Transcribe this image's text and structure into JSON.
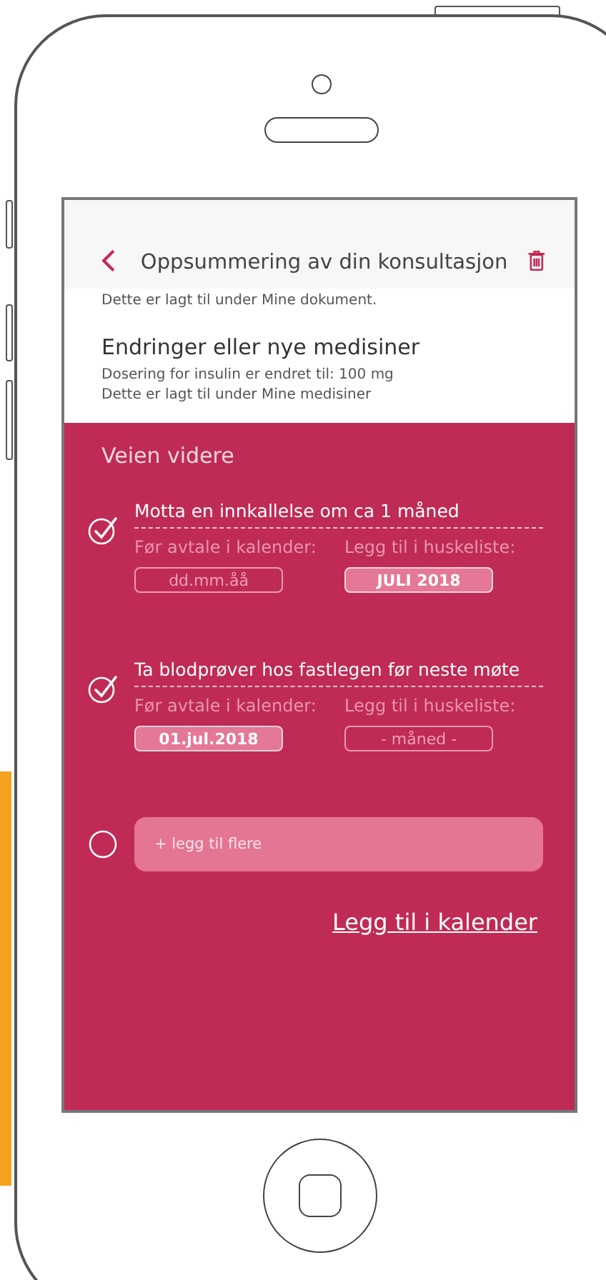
{
  "header": {
    "title": "Oppsummering av din konsultasjon"
  },
  "intro_text": "Dette er lagt til under Mine dokument.",
  "medicine": {
    "title": "Endringer eller nye medisiner",
    "lines": [
      "Dosering for insulin er endret til: 100 mg",
      "Dette er lagt til under Mine medisiner"
    ]
  },
  "next_steps": {
    "title": "Veien videre",
    "tasks": [
      {
        "title": "Motta en innkallelse om ca 1 måned",
        "checked": true,
        "calendar_label": "Før avtale i kalender:",
        "calendar_field": {
          "placeholder": "dd.mm.åå"
        },
        "reminder_label": "Legg til i huskeliste:",
        "reminder_field": {
          "value": "JULI 2018"
        }
      },
      {
        "title": "Ta blodprøver hos fastlegen før neste møte",
        "checked": true,
        "calendar_label": "Før avtale i kalender:",
        "calendar_field": {
          "value": "01.jul.2018"
        },
        "reminder_label": "Legg til i huskeliste:",
        "reminder_field": {
          "placeholder": "- måned -"
        }
      }
    ],
    "add": {
      "checked": false,
      "placeholder": "+ legg til flere"
    },
    "link": "Legg til i kalender"
  }
}
